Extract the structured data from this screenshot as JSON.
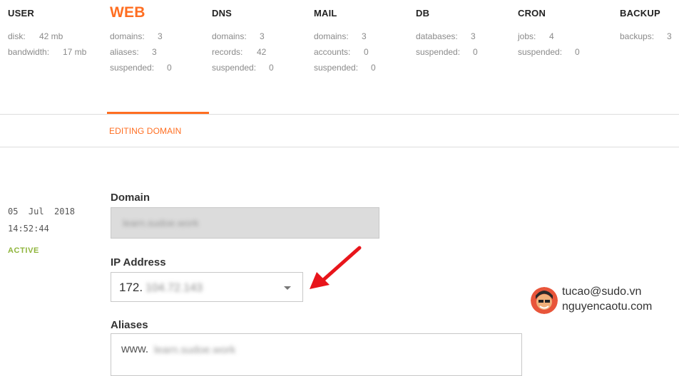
{
  "stats": {
    "user": {
      "title": "USER",
      "rows": [
        {
          "label": "disk:",
          "value": "42 mb"
        },
        {
          "label": "bandwidth:",
          "value": "17 mb"
        }
      ]
    },
    "web": {
      "title": "WEB",
      "rows": [
        {
          "label": "domains:",
          "value": "3"
        },
        {
          "label": "aliases:",
          "value": "3"
        },
        {
          "label": "suspended:",
          "value": "0"
        }
      ]
    },
    "dns": {
      "title": "DNS",
      "rows": [
        {
          "label": "domains:",
          "value": "3"
        },
        {
          "label": "records:",
          "value": "42"
        },
        {
          "label": "suspended:",
          "value": "0"
        }
      ]
    },
    "mail": {
      "title": "MAIL",
      "rows": [
        {
          "label": "domains:",
          "value": "3"
        },
        {
          "label": "accounts:",
          "value": "0"
        },
        {
          "label": "suspended:",
          "value": "0"
        }
      ]
    },
    "db": {
      "title": "DB",
      "rows": [
        {
          "label": "databases:",
          "value": "3"
        },
        {
          "label": "suspended:",
          "value": "0"
        }
      ]
    },
    "cron": {
      "title": "CRON",
      "rows": [
        {
          "label": "jobs:",
          "value": "4"
        },
        {
          "label": "suspended:",
          "value": "0"
        }
      ]
    },
    "backup": {
      "title": "BACKUP",
      "rows": [
        {
          "label": "backups:",
          "value": "3"
        }
      ]
    }
  },
  "section_title": "EDITING DOMAIN",
  "meta": {
    "date": "05  Jul  2018",
    "time": "14:52:44",
    "status": "ACTIVE"
  },
  "form": {
    "domain_label": "Domain",
    "domain_value": "learn.sudoe.work",
    "ip_label": "IP Address",
    "ip_prefix": "172.",
    "ip_rest": "104.72.143",
    "aliases_label": "Aliases",
    "alias_prefix": "www.",
    "alias_rest": "learn.sudoe.work"
  },
  "watermark": {
    "email": "tucao@sudo.vn",
    "site": "nguyencaotu.com"
  },
  "colors": {
    "accent": "#ff6e21",
    "active": "#8fb53c",
    "arrow": "#e8151b"
  }
}
